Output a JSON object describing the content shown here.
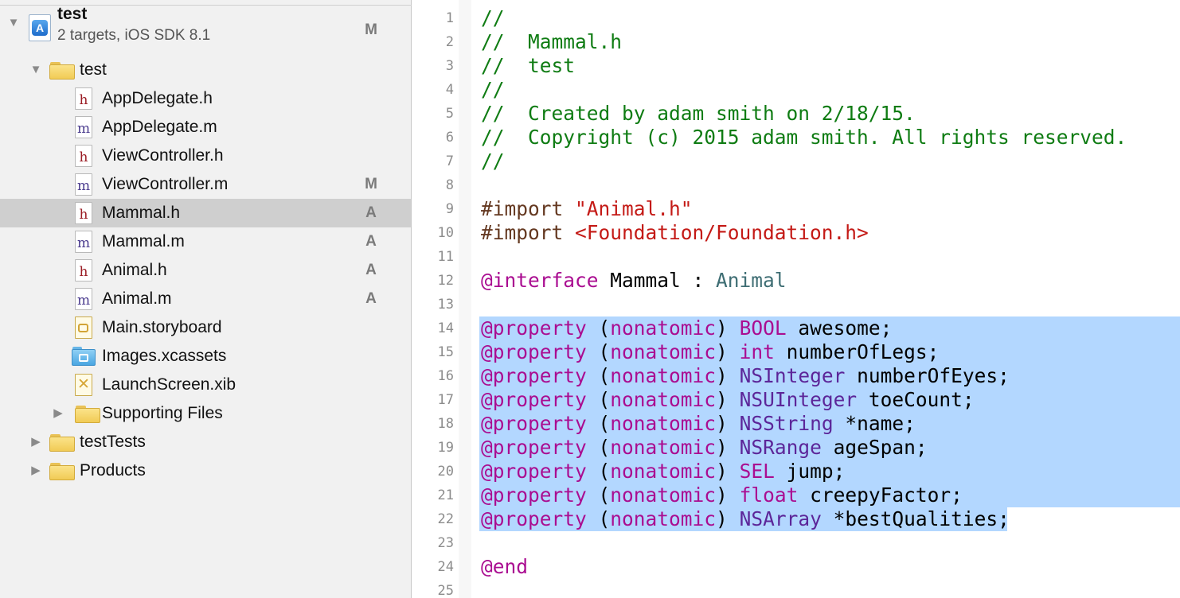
{
  "navigator": {
    "project": {
      "name": "test",
      "subtitle": "2 targets, iOS SDK 8.1",
      "status": "M"
    },
    "items": [
      {
        "label": "test",
        "kind": "folder",
        "expanded": true,
        "status": ""
      },
      {
        "label": "AppDelegate.h",
        "kind": "h-file",
        "status": ""
      },
      {
        "label": "AppDelegate.m",
        "kind": "m-file",
        "status": ""
      },
      {
        "label": "ViewController.h",
        "kind": "h-file",
        "status": ""
      },
      {
        "label": "ViewController.m",
        "kind": "m-file",
        "status": "M"
      },
      {
        "label": "Mammal.h",
        "kind": "h-file",
        "status": "A",
        "selected": true
      },
      {
        "label": "Mammal.m",
        "kind": "m-file",
        "status": "A"
      },
      {
        "label": "Animal.h",
        "kind": "h-file",
        "status": "A"
      },
      {
        "label": "Animal.m",
        "kind": "m-file",
        "status": "A"
      },
      {
        "label": "Main.storyboard",
        "kind": "storyboard",
        "status": ""
      },
      {
        "label": "Images.xcassets",
        "kind": "xcassets",
        "status": ""
      },
      {
        "label": "LaunchScreen.xib",
        "kind": "xib",
        "status": ""
      },
      {
        "label": "Supporting Files",
        "kind": "folder",
        "expanded": false,
        "status": ""
      },
      {
        "label": "testTests",
        "kind": "folder",
        "expanded": false,
        "status": ""
      },
      {
        "label": "Products",
        "kind": "folder",
        "expanded": false,
        "status": ""
      }
    ]
  },
  "editor": {
    "line_numbers": [
      "1",
      "2",
      "3",
      "4",
      "5",
      "6",
      "7",
      "8",
      "9",
      "10",
      "11",
      "12",
      "13",
      "14",
      "15",
      "16",
      "17",
      "18",
      "19",
      "20",
      "21",
      "22",
      "23",
      "24",
      "25"
    ],
    "lines": [
      [
        {
          "t": "//",
          "c": "comment"
        }
      ],
      [
        {
          "t": "//  Mammal.h",
          "c": "comment"
        }
      ],
      [
        {
          "t": "//  test",
          "c": "comment"
        }
      ],
      [
        {
          "t": "//",
          "c": "comment"
        }
      ],
      [
        {
          "t": "//  Created by adam smith on 2/18/15.",
          "c": "comment"
        }
      ],
      [
        {
          "t": "//  Copyright (c) 2015 adam smith. All rights reserved.",
          "c": "comment"
        }
      ],
      [
        {
          "t": "//",
          "c": "comment"
        }
      ],
      [],
      [
        {
          "t": "#import ",
          "c": "pre"
        },
        {
          "t": "\"Animal.h\"",
          "c": "str"
        }
      ],
      [
        {
          "t": "#import ",
          "c": "pre"
        },
        {
          "t": "<Foundation/Foundation.h>",
          "c": "str"
        }
      ],
      [],
      [
        {
          "t": "@interface",
          "c": "kw"
        },
        {
          "t": " Mammal : ",
          "c": "plain"
        },
        {
          "t": "Animal",
          "c": "class"
        }
      ],
      [],
      [
        {
          "t": "@property",
          "c": "kw"
        },
        {
          "t": " (",
          "c": "plain"
        },
        {
          "t": "nonatomic",
          "c": "kw"
        },
        {
          "t": ") ",
          "c": "plain"
        },
        {
          "t": "BOOL",
          "c": "kw"
        },
        {
          "t": " awesome;",
          "c": "plain"
        }
      ],
      [
        {
          "t": "@property",
          "c": "kw"
        },
        {
          "t": " (",
          "c": "plain"
        },
        {
          "t": "nonatomic",
          "c": "kw"
        },
        {
          "t": ") ",
          "c": "plain"
        },
        {
          "t": "int",
          "c": "kw"
        },
        {
          "t": " numberOfLegs;",
          "c": "plain"
        }
      ],
      [
        {
          "t": "@property",
          "c": "kw"
        },
        {
          "t": " (",
          "c": "plain"
        },
        {
          "t": "nonatomic",
          "c": "kw"
        },
        {
          "t": ") ",
          "c": "plain"
        },
        {
          "t": "NSInteger",
          "c": "type"
        },
        {
          "t": " numberOfEyes;",
          "c": "plain"
        }
      ],
      [
        {
          "t": "@property",
          "c": "kw"
        },
        {
          "t": " (",
          "c": "plain"
        },
        {
          "t": "nonatomic",
          "c": "kw"
        },
        {
          "t": ") ",
          "c": "plain"
        },
        {
          "t": "NSUInteger",
          "c": "type"
        },
        {
          "t": " toeCount;",
          "c": "plain"
        }
      ],
      [
        {
          "t": "@property",
          "c": "kw"
        },
        {
          "t": " (",
          "c": "plain"
        },
        {
          "t": "nonatomic",
          "c": "kw"
        },
        {
          "t": ") ",
          "c": "plain"
        },
        {
          "t": "NSString",
          "c": "type"
        },
        {
          "t": " *name;",
          "c": "plain"
        }
      ],
      [
        {
          "t": "@property",
          "c": "kw"
        },
        {
          "t": " (",
          "c": "plain"
        },
        {
          "t": "nonatomic",
          "c": "kw"
        },
        {
          "t": ") ",
          "c": "plain"
        },
        {
          "t": "NSRange",
          "c": "type"
        },
        {
          "t": " ageSpan;",
          "c": "plain"
        }
      ],
      [
        {
          "t": "@property",
          "c": "kw"
        },
        {
          "t": " (",
          "c": "plain"
        },
        {
          "t": "nonatomic",
          "c": "kw"
        },
        {
          "t": ") ",
          "c": "plain"
        },
        {
          "t": "SEL",
          "c": "kw"
        },
        {
          "t": " jump;",
          "c": "plain"
        }
      ],
      [
        {
          "t": "@property",
          "c": "kw"
        },
        {
          "t": " (",
          "c": "plain"
        },
        {
          "t": "nonatomic",
          "c": "kw"
        },
        {
          "t": ") ",
          "c": "plain"
        },
        {
          "t": "float",
          "c": "kw"
        },
        {
          "t": " creepyFactor;",
          "c": "plain"
        }
      ],
      [
        {
          "t": "@property",
          "c": "kw"
        },
        {
          "t": " (",
          "c": "plain"
        },
        {
          "t": "nonatomic",
          "c": "kw"
        },
        {
          "t": ") ",
          "c": "plain"
        },
        {
          "t": "NSArray",
          "c": "type"
        },
        {
          "t": " *bestQualities;",
          "c": "plain"
        }
      ],
      [],
      [
        {
          "t": "@end",
          "c": "kw"
        }
      ],
      []
    ],
    "selected_lines": [
      "14",
      "15",
      "16",
      "17",
      "18",
      "19",
      "20",
      "21",
      "22"
    ]
  },
  "colors": {
    "comment": "#0f7c13",
    "preprocessor": "#643820",
    "string": "#c41a16",
    "keyword": "#aa0d91",
    "type": "#5c2699",
    "class": "#3f6e74",
    "selection": "#b3d7ff",
    "navigator_selection": "#cfcfcf"
  }
}
